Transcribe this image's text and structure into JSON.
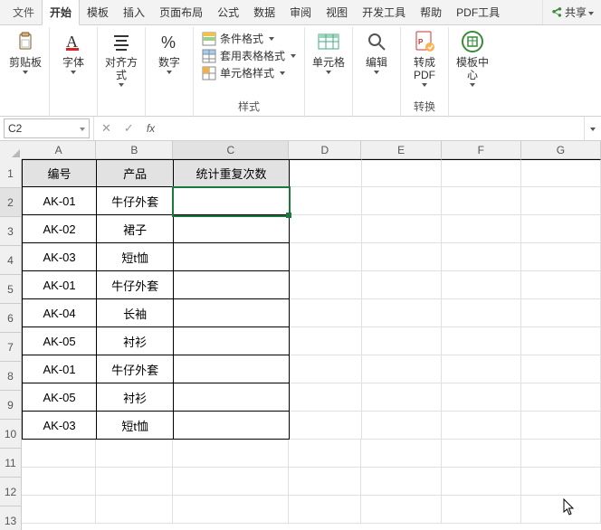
{
  "tabs": {
    "file": "文件",
    "home": "开始",
    "tpl": "模板",
    "insert": "插入",
    "pagelayout": "页面布局",
    "formula": "公式",
    "data": "数据",
    "review": "审阅",
    "view": "视图",
    "dev": "开发工具",
    "help": "帮助",
    "pdf": "PDF工具"
  },
  "share": "共享",
  "ribbon": {
    "clipboard": "剪贴板",
    "font": "字体",
    "align": "对齐方式",
    "number": "数字",
    "styles": {
      "cond": "条件格式",
      "table": "套用表格格式",
      "cell": "单元格样式",
      "label": "样式"
    },
    "cells": "单元格",
    "edit": "编辑",
    "pdfconv": "转成PDF",
    "convert": "转换",
    "tplcenter": "模板中心"
  },
  "namebox": "C2",
  "colheads": [
    "A",
    "B",
    "C",
    "D",
    "E",
    "F",
    "G"
  ],
  "rows": 13,
  "table": {
    "header": [
      "编号",
      "产品",
      "统计重复次数"
    ],
    "data": [
      [
        "AK-01",
        "牛仔外套",
        ""
      ],
      [
        "AK-02",
        "裙子",
        ""
      ],
      [
        "AK-03",
        "短t恤",
        ""
      ],
      [
        "AK-01",
        "牛仔外套",
        ""
      ],
      [
        "AK-04",
        "长袖",
        ""
      ],
      [
        "AK-05",
        "衬衫",
        ""
      ],
      [
        "AK-01",
        "牛仔外套",
        ""
      ],
      [
        "AK-05",
        "衬衫",
        ""
      ],
      [
        "AK-03",
        "短t恤",
        ""
      ]
    ]
  },
  "active": {
    "col": "C",
    "row": 2
  }
}
